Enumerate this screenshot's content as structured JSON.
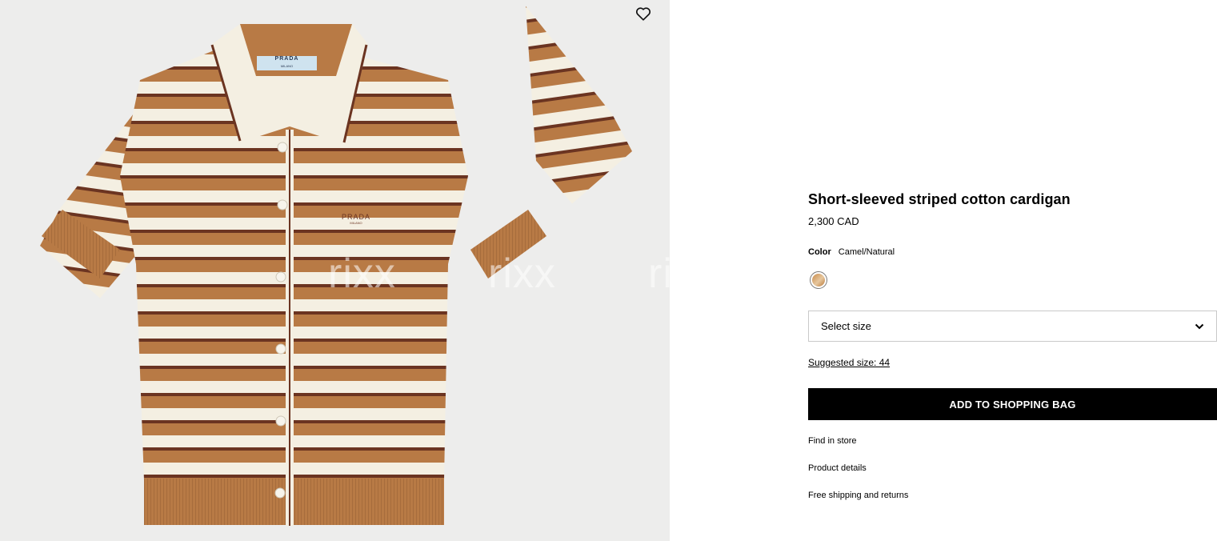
{
  "gallery": {
    "wishlist_icon": "heart-outline-icon",
    "watermark": [
      "rixx",
      "rixx",
      "ri"
    ],
    "label_brand": "PRADA",
    "label_sub": "MILANO",
    "embroidery_brand": "PRADA",
    "embroidery_sub": "MILANO",
    "colors": {
      "background": "#ededec",
      "camel": "#b87a45",
      "cream": "#f4efe2",
      "brown": "#6b3421"
    }
  },
  "product": {
    "title": "Short-sleeved striped cotton cardigan",
    "price": "2,300 CAD",
    "color_label": "Color",
    "color_value": "Camel/Natural",
    "size_placeholder": "Select size",
    "suggested_size": "Suggested size: 44",
    "add_to_bag": "ADD TO SHOPPING BAG",
    "links": {
      "find_in_store": "Find in store",
      "product_details": "Product details",
      "shipping": "Free shipping and returns"
    }
  }
}
